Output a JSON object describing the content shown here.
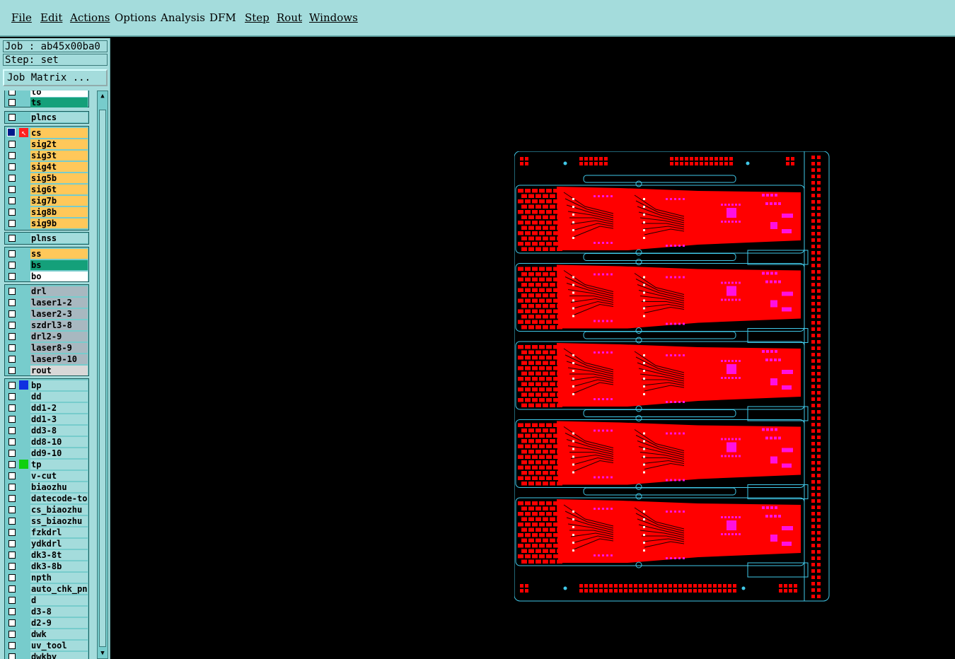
{
  "menu": {
    "file": "File",
    "edit": "Edit",
    "actions": "Actions",
    "options": "Options",
    "analysis": "Analysis",
    "dfm": "DFM",
    "step": "Step",
    "rout": "Rout",
    "windows": "Windows"
  },
  "job_label": "Job : ab45x00ba0",
  "step_label": "Step: set",
  "job_matrix_button": "Job Matrix ...",
  "layers": {
    "to": "to",
    "ts": "ts",
    "plncs": "plncs",
    "cs": "cs",
    "sig2t": "sig2t",
    "sig3t": "sig3t",
    "sig4t": "sig4t",
    "sig5b": "sig5b",
    "sig6t": "sig6t",
    "sig7b": "sig7b",
    "sig8b": "sig8b",
    "sig9b": "sig9b",
    "plnss": "plnss",
    "ss": "ss",
    "bs": "bs",
    "bo": "bo",
    "drl": "drl",
    "laser1_2": "laser1-2",
    "laser2_3": "laser2-3",
    "szdrl3_8": "szdrl3-8",
    "drl2_9": "drl2-9",
    "laser8_9": "laser8-9",
    "laser9_10": "laser9-10",
    "rout": "rout",
    "bp": "bp",
    "dd": "dd",
    "dd1_2": "dd1-2",
    "dd1_3": "dd1-3",
    "dd3_8": "dd3-8",
    "dd8_10": "dd8-10",
    "dd9_10": "dd9-10",
    "tp": "tp",
    "v_cut": "v-cut",
    "biaozhu": "biaozhu",
    "datecode_to": "datecode-to",
    "cs_biaozhu": "cs_biaozhu",
    "ss_biaozhu": "ss_biaozhu",
    "fzkdrl": "fzkdrl",
    "ydkdrl": "ydkdrl",
    "dk3_8t": "dk3-8t",
    "dk3_8b": "dk3-8b",
    "npth": "npth",
    "auto_chk_pn": "auto_chk_pn.",
    "d": "d",
    "d3_8": "d3-8",
    "d2_9": "d2-9",
    "dwk": "dwk",
    "uv_tool": "uv_tool",
    "dwkby": "dwkby"
  },
  "colors": {
    "menu_bg": "#a4dcdc",
    "signal_layer": "#ffc85a",
    "solder_layer": "#14a07a",
    "drill_layer": "#a8b8c0",
    "doc_layer": "#a4dcdc",
    "copper_red": "#ff0000",
    "pad_magenta": "#ff10e0",
    "outline_cyan": "#40c8e8"
  }
}
